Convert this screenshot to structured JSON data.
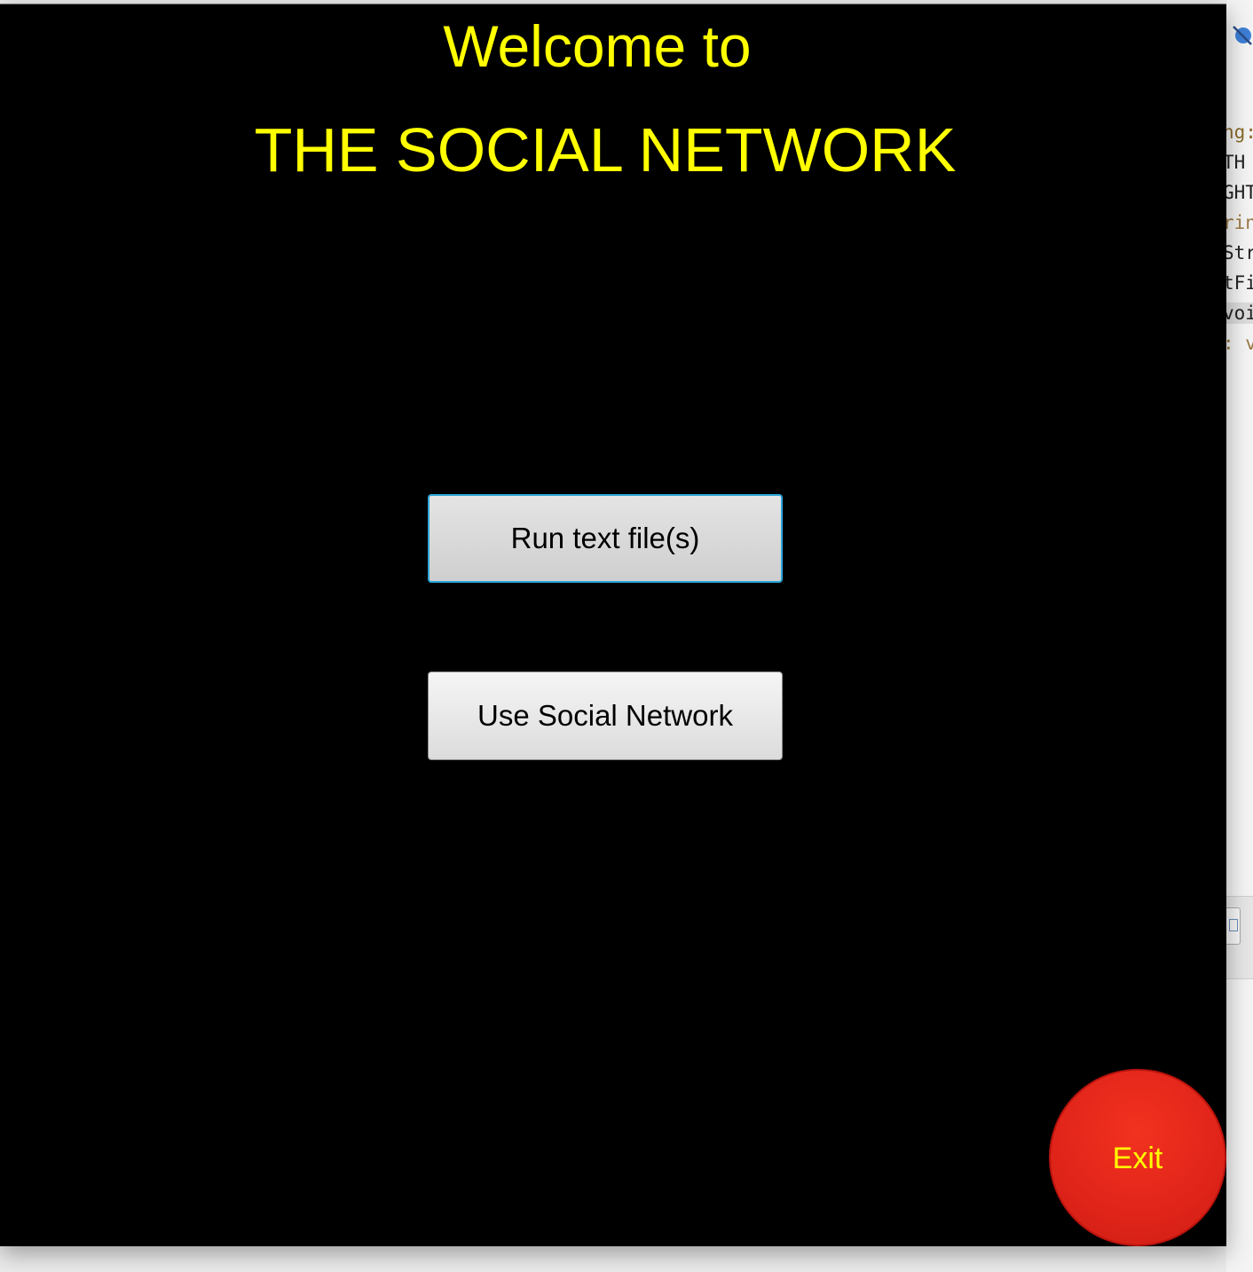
{
  "window": {
    "welcome_line": "Welcome to",
    "title_line": "THE SOCIAL NETWORK",
    "title_color": "#ffff00",
    "background_color": "#000000"
  },
  "buttons": {
    "run_label": "Run text file(s)",
    "use_label": "Use Social Network",
    "exit_label": "Exit",
    "exit_color": "#e0241a",
    "focus_color": "#2aa6d8"
  },
  "background_editor": {
    "lines": [
      "ng:",
      "TH",
      "GHT",
      "ring",
      "Stri",
      "tFie",
      "void",
      ": vo"
    ],
    "icon": "debug-breakpoint-icon",
    "panel_icon": "panel-toggle-icon"
  }
}
